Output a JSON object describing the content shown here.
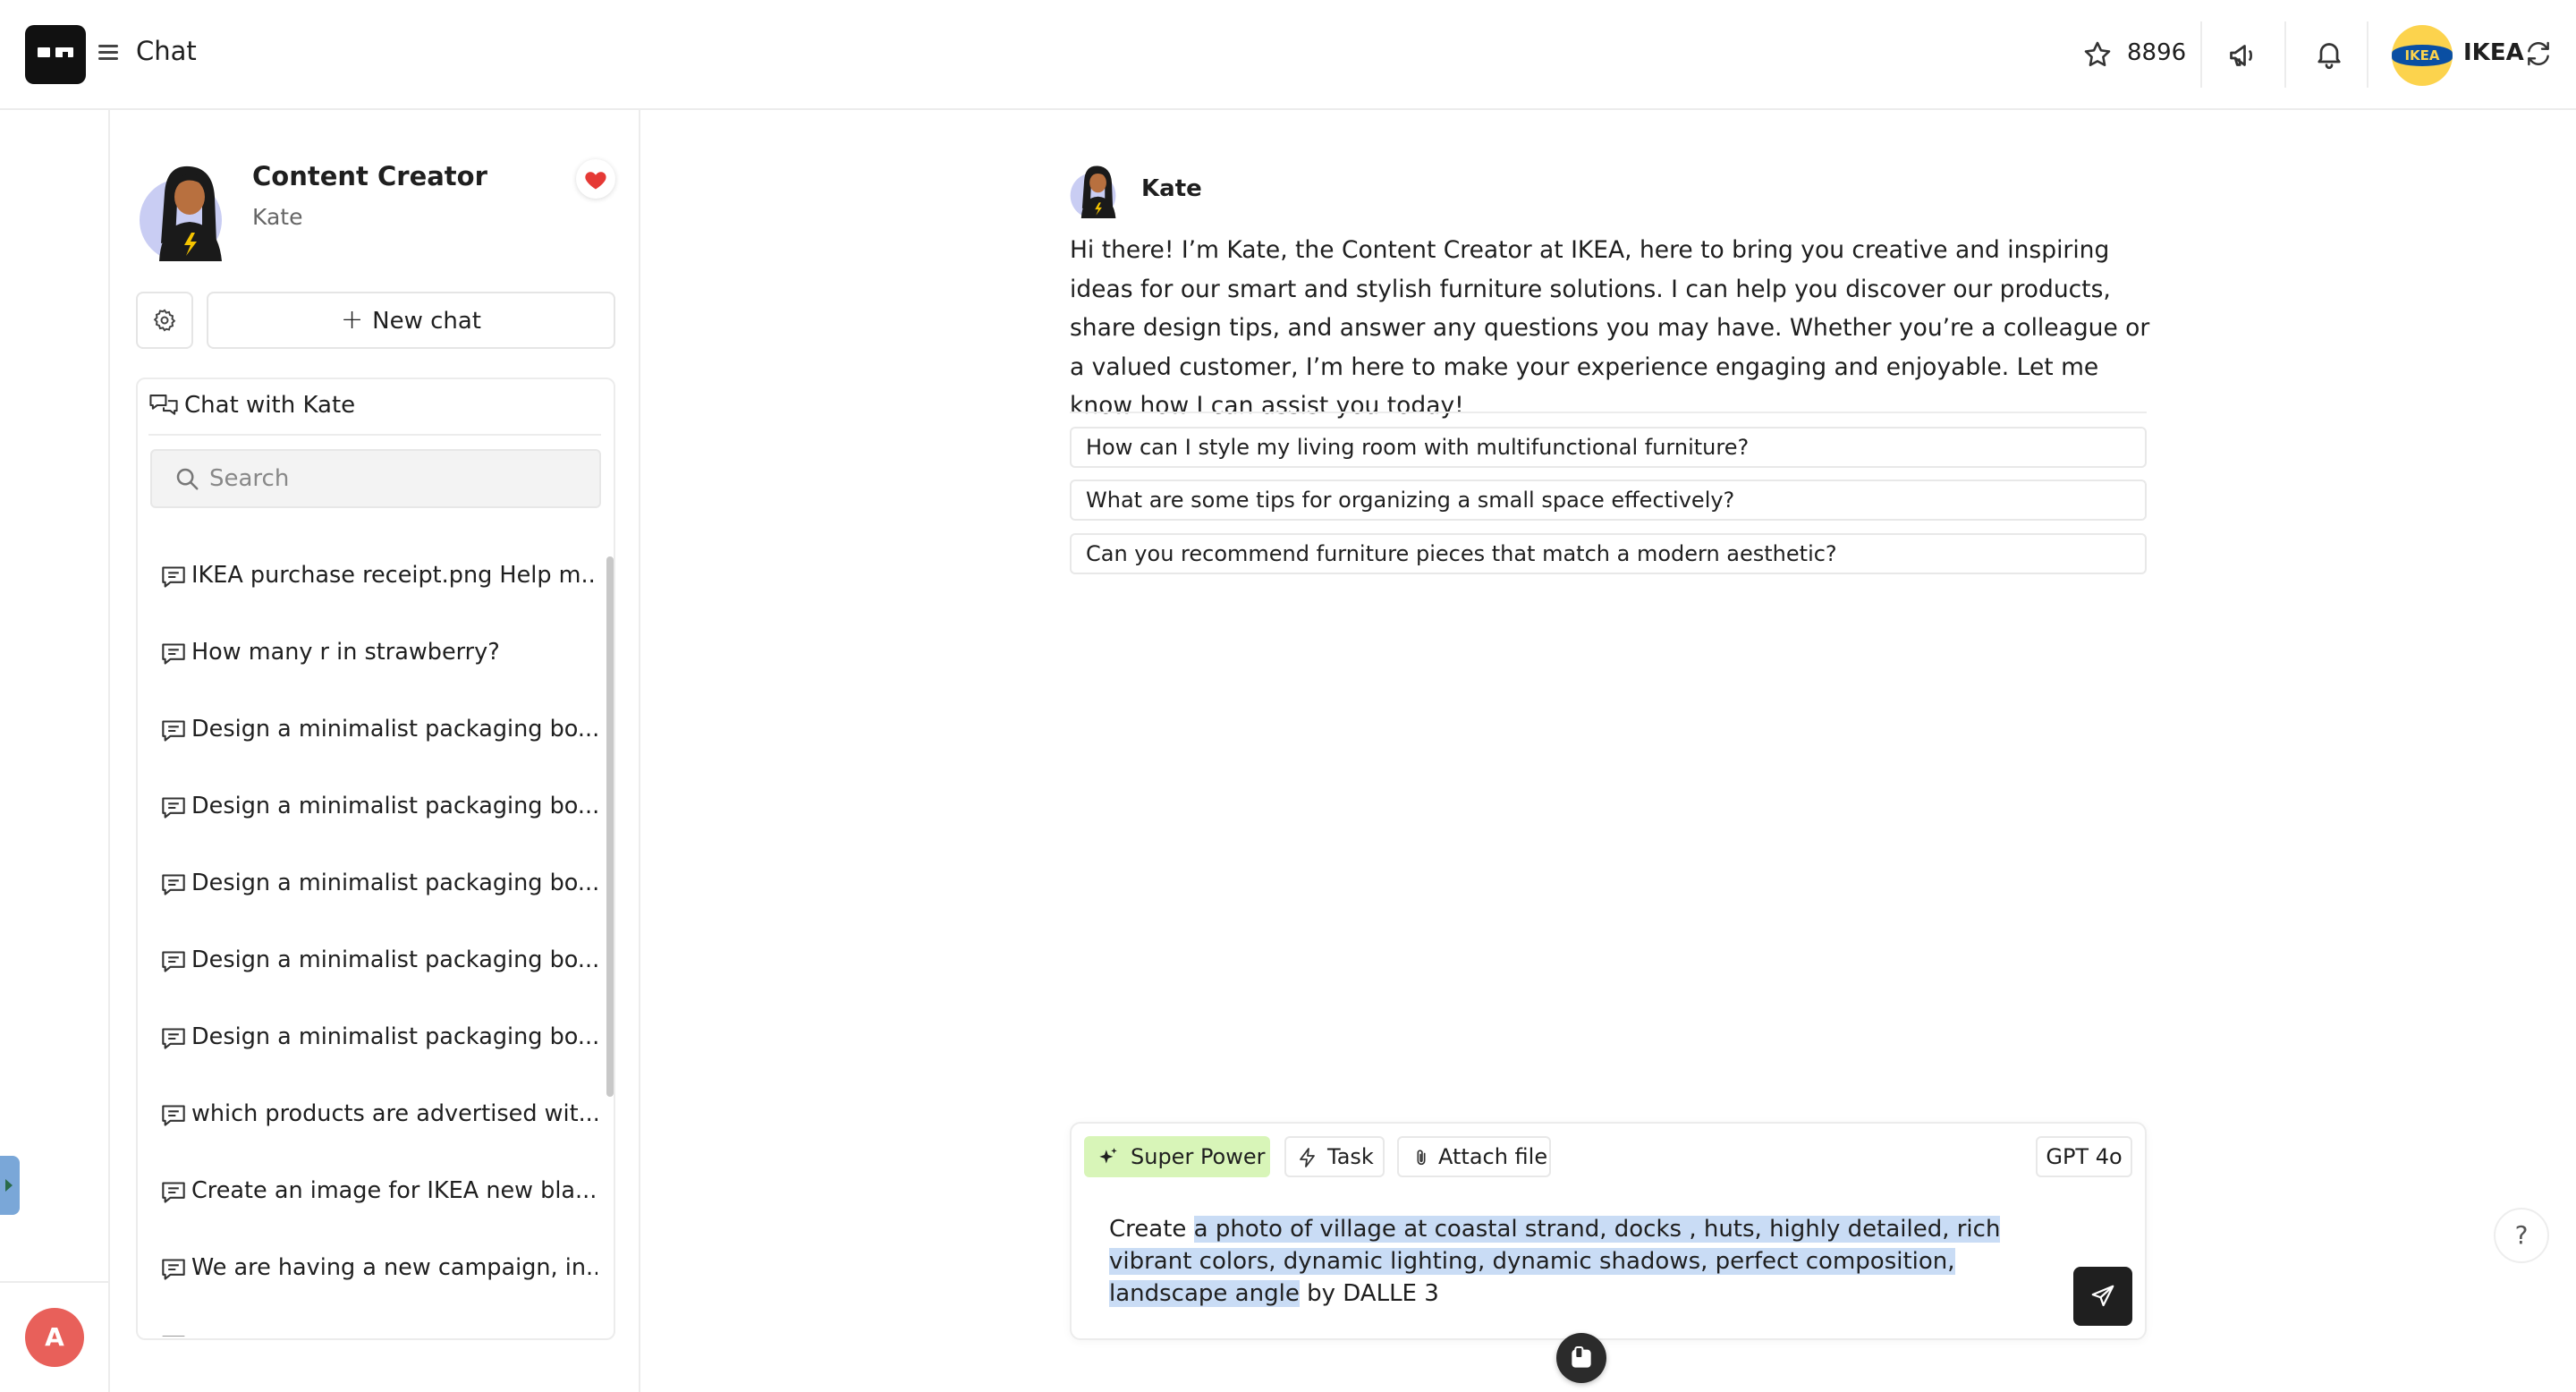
{
  "header": {
    "title": "Chat",
    "credits": "8896",
    "org_name": "IKEA",
    "org_logo_text": "IKEA"
  },
  "user": {
    "initial": "A"
  },
  "assistant": {
    "role": "Content Creator",
    "name": "Kate",
    "favorited": true
  },
  "sidebar": {
    "new_chat_label": "New chat",
    "history_title": "Chat with Kate",
    "search_placeholder": "Search",
    "items": [
      {
        "label": "IKEA purchase receipt.png Help m..."
      },
      {
        "label": "How many r in strawberry?"
      },
      {
        "label": "Design a minimalist packaging bo..."
      },
      {
        "label": "Design a minimalist packaging bo..."
      },
      {
        "label": "Design a minimalist packaging bo..."
      },
      {
        "label": "Design a minimalist packaging bo..."
      },
      {
        "label": "Design a minimalist packaging bo..."
      },
      {
        "label": "which products are advertised wit..."
      },
      {
        "label": "Create an image for IKEA new bla..."
      },
      {
        "label": "We are having a new campaign, in..."
      }
    ]
  },
  "conversation": {
    "author": "Kate",
    "message": "Hi there! I’m Kate, the Content Creator at IKEA, here to bring you creative and inspiring ideas for our smart and stylish furniture solutions. I can help you discover our products, share design tips, and answer any questions you may have. Whether you’re a colleague or a valued customer, I’m here to make your experience engaging and enjoyable. Let me know how I can assist you today!",
    "suggestions": [
      "How can I style my living room with multifunctional furniture?",
      "What are some tips for organizing a small space effectively?",
      "Can you recommend furniture pieces that match a modern aesthetic?"
    ]
  },
  "composer": {
    "superpower_label": "Super Power",
    "task_label": "Task",
    "attach_label": "Attach file",
    "model": "GPT 4o",
    "prompt_before": "Create ",
    "prompt_selected": "a photo of village at coastal strand, docks , huts, highly detailed, rich vibrant colors, dynamic lighting, dynamic shadows, perfect composition, landscape angle",
    "prompt_after": " by DALLE 3"
  },
  "help_label": "?",
  "colors": {
    "accent_dark": "#1f1f1f",
    "superpower_bg": "#d8f5b8",
    "selection": "#c9dcf5",
    "favorite": "#e53935",
    "user_avatar": "#e8605a",
    "org_yellow": "#fcd34d",
    "org_blue": "#0a4fa3"
  }
}
